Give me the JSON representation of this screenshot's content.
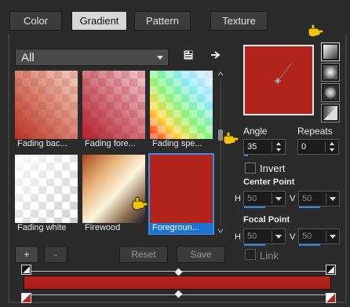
{
  "tabs": [
    {
      "label": "Color",
      "active": false
    },
    {
      "label": "Gradient",
      "active": true
    },
    {
      "label": "Pattern",
      "active": false
    },
    {
      "label": "Texture",
      "active": false
    }
  ],
  "category": {
    "selected": "All"
  },
  "thumbnails": [
    {
      "label": "Fading bac..."
    },
    {
      "label": "Fading fore..."
    },
    {
      "label": "Fading spe..."
    },
    {
      "label": "Fading white"
    },
    {
      "label": "Firewood"
    },
    {
      "label": "Foregroun...",
      "selected": true
    }
  ],
  "buttons": {
    "add": "+",
    "remove": "-",
    "reset": "Reset",
    "save": "Save"
  },
  "angle": {
    "label": "Angle",
    "value": "35"
  },
  "repeats": {
    "label": "Repeats",
    "value": "0"
  },
  "invert": {
    "label": "Invert",
    "checked": false
  },
  "center_point": {
    "label": "Center Point",
    "h_label": "H",
    "h_value": "50",
    "v_label": "V",
    "v_value": "50"
  },
  "focal_point": {
    "label": "Focal Point",
    "h_label": "H",
    "h_value": "50",
    "v_label": "V",
    "v_value": "50"
  },
  "link": {
    "label": "Link",
    "checked": false
  },
  "colors": {
    "accent": "#2f8ae0",
    "gradient_start": "#b52319",
    "gradient_end": "#a81e16",
    "preview": "#b1231b",
    "selection": "#1e73d0",
    "cursor_hand": "#f2c400"
  }
}
